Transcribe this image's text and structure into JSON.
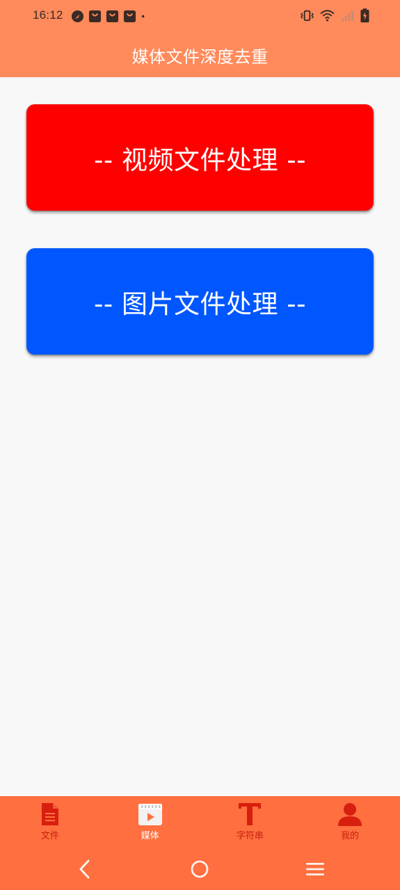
{
  "status_bar": {
    "time": "16:12",
    "left_icons": [
      "navigation-icon",
      "shopping-bag-icon",
      "shopping-bag-icon",
      "shopping-bag-icon",
      "dot-icon"
    ],
    "right_icons": [
      "vibrate-icon",
      "wifi-icon",
      "signal-icon",
      "battery-charging-icon"
    ]
  },
  "header": {
    "title": "媒体文件深度去重",
    "bg_color": "#FF8A5B"
  },
  "buttons": {
    "video": {
      "label": "-- 视频文件处理 --",
      "color": "#FF0000"
    },
    "image": {
      "label": "-- 图片文件处理 --",
      "color": "#0057FF"
    }
  },
  "bottom_nav": {
    "bg_color": "#FF6F3F",
    "items": [
      {
        "label": "文件",
        "icon": "document-icon",
        "active": false
      },
      {
        "label": "媒体",
        "icon": "video-clapper-icon",
        "active": true
      },
      {
        "label": "字符串",
        "icon": "text-t-icon",
        "active": false
      },
      {
        "label": "我的",
        "icon": "person-icon",
        "active": false
      }
    ]
  },
  "system_nav": {
    "icons": [
      "back-icon",
      "home-icon",
      "menu-icon"
    ]
  }
}
